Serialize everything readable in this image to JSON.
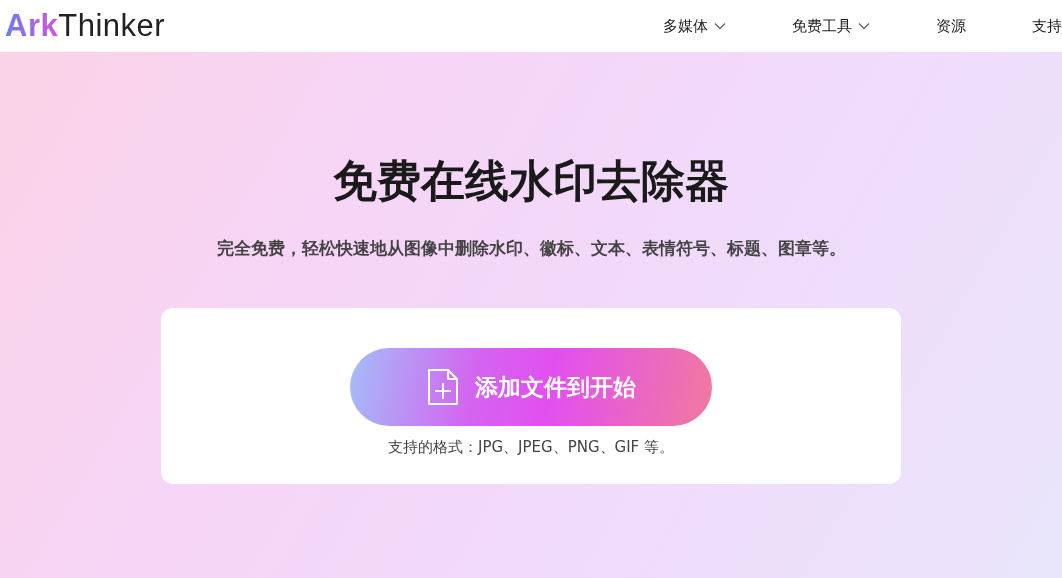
{
  "header": {
    "logo": {
      "accent": "Ark",
      "text": "Thinker"
    },
    "nav": [
      {
        "label": "多媒体",
        "has_menu": true
      },
      {
        "label": "免费工具",
        "has_menu": true
      },
      {
        "label": "资源",
        "has_menu": false
      },
      {
        "label": "支持",
        "has_menu": false
      }
    ]
  },
  "hero": {
    "title": "免费在线水印去除器",
    "subtitle": "完全免费，轻松快速地从图像中删除水印、徽标、文本、表情符号、标题、图章等。"
  },
  "upload": {
    "button": "添加文件到开始",
    "formats": "支持的格式：JPG、JPEG、PNG、GIF 等。"
  }
}
